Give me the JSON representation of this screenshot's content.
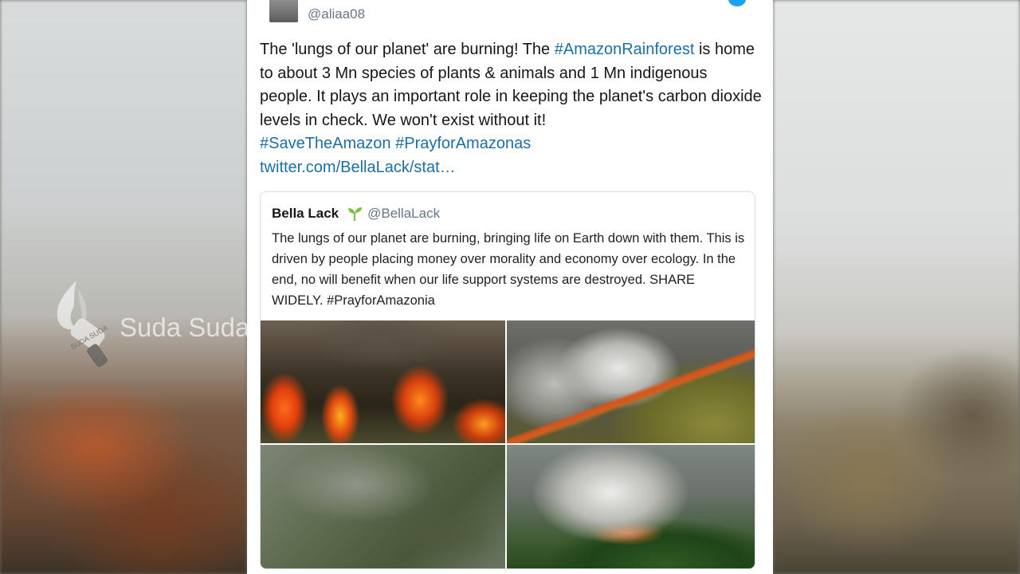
{
  "tweet": {
    "handle": "@aliaa08",
    "text_parts": {
      "p1": "The 'lungs of our planet' are burning! The ",
      "hashtag1": "#AmazonRainforest",
      "p2": " is home to about 3 Mn species of plants & animals and 1 Mn indigenous people. It plays an important role in keeping the planet's carbon dioxide levels in check. We won't exist without it!",
      "hashtag2": "#SaveTheAmazon",
      "hashtag3": "#PrayforAmazonas",
      "link": "twitter.com/BellaLack/stat…"
    }
  },
  "quoted_tweet": {
    "name": "Bella Lack",
    "badge_icon": "seedling-icon",
    "handle": "@BellaLack",
    "text": "The lungs of our planet are burning, bringing life on Earth down with them. This is driven by people placing money over morality and economy over ecology. In the end, no will benefit when our life support systems are destroyed. SHARE WIDELY. #PrayforAmazonia",
    "photos": [
      "forest-fire-photo",
      "aerial-burning-forest-photo",
      "satellite-smoke-photo",
      "smoke-over-forest-photo"
    ]
  },
  "watermark": {
    "logo_text": "SUDA SUDA",
    "text": "Suda Suda"
  },
  "colors": {
    "link": "#1b6fa5",
    "handle": "#657786",
    "badge": "#7ac143"
  }
}
